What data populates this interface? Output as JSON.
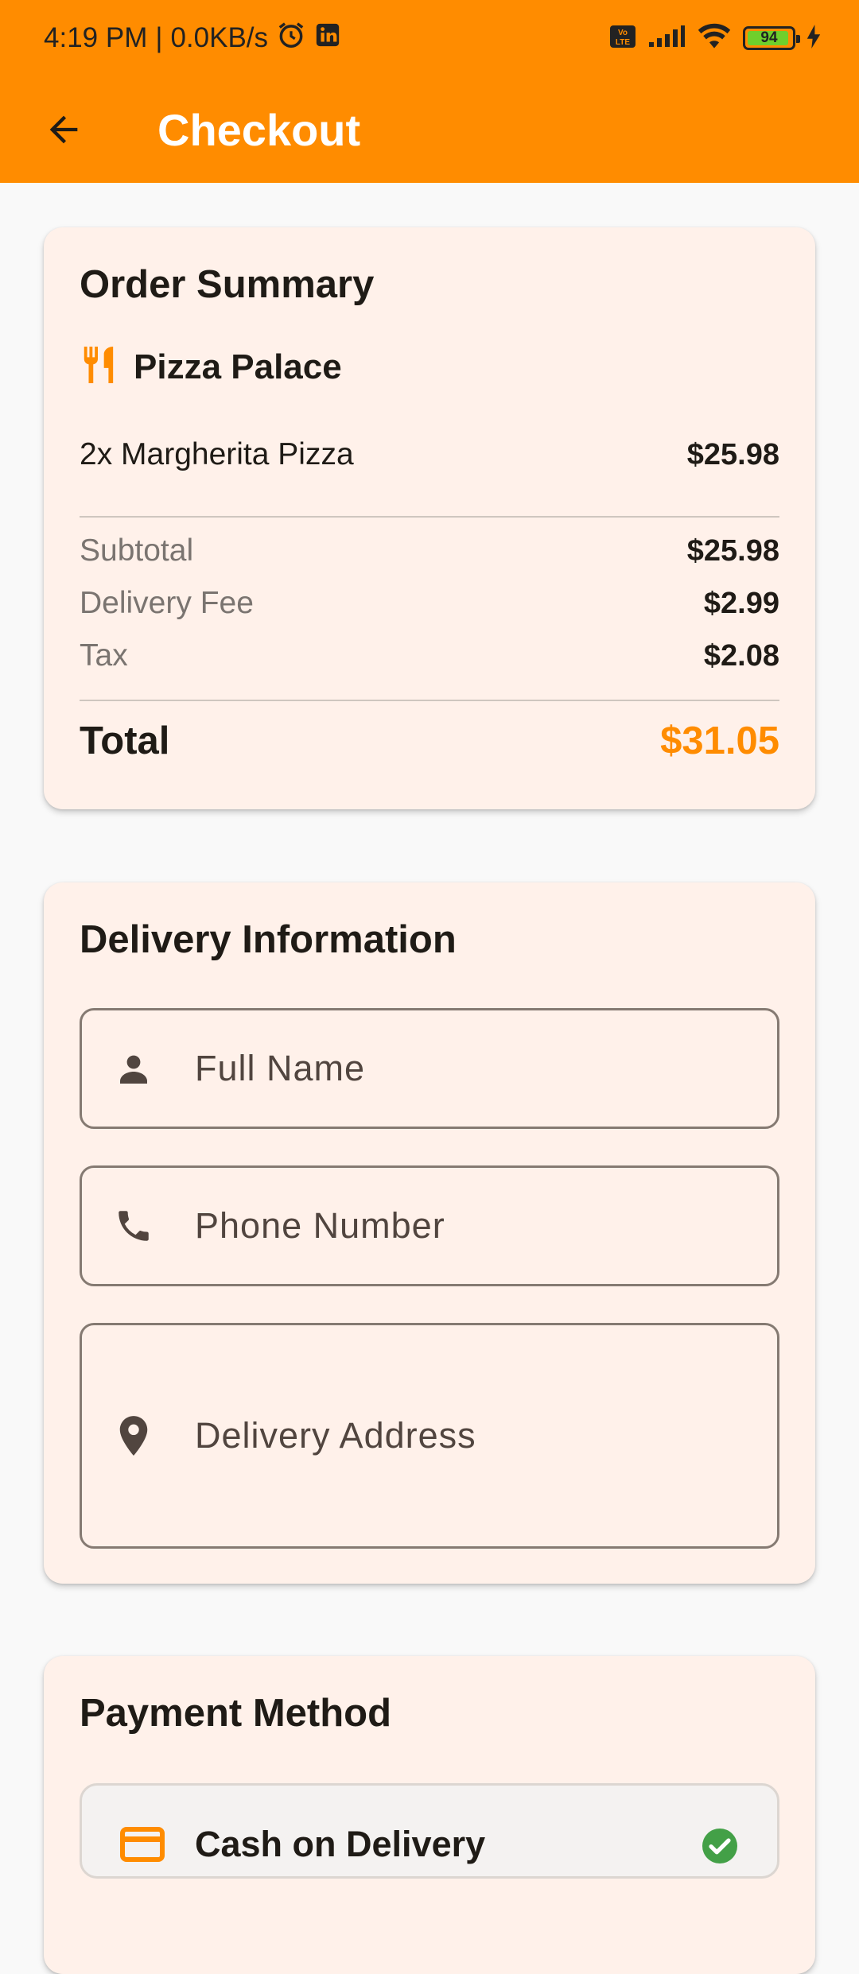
{
  "status_bar": {
    "time": "4:19 PM",
    "separator": "|",
    "net_speed": "0.0KB/s",
    "battery_level": 94,
    "icons": [
      "alarm-icon",
      "linkedin-icon",
      "volte-icon",
      "signal-icon",
      "wifi-icon",
      "battery-icon",
      "charging-icon"
    ]
  },
  "appbar": {
    "title": "Checkout",
    "background_color": "#ff8c00",
    "back_icon": "arrow-back-icon"
  },
  "order_summary": {
    "title": "Order Summary",
    "restaurant": {
      "icon": "restaurant-icon",
      "name": "Pizza Palace"
    },
    "items": [
      {
        "label": "2x Margherita Pizza",
        "price": "$25.98"
      }
    ],
    "subtotal": {
      "label": "Subtotal",
      "value": "$25.98"
    },
    "delivery_fee": {
      "label": "Delivery Fee",
      "value": "$2.99"
    },
    "tax": {
      "label": "Tax",
      "value": "$2.08"
    },
    "total": {
      "label": "Total",
      "value": "$31.05"
    }
  },
  "delivery_information": {
    "title": "Delivery Information",
    "fields": {
      "full_name": {
        "icon": "person-icon",
        "placeholder": "Full Name",
        "value": ""
      },
      "phone": {
        "icon": "phone-icon",
        "placeholder": "Phone Number",
        "value": ""
      },
      "address": {
        "icon": "location-icon",
        "placeholder": "Delivery Address",
        "value": ""
      }
    }
  },
  "payment_method": {
    "title": "Payment Method",
    "options": [
      {
        "label": "Cash on Delivery",
        "icon": "card-icon",
        "selected": true
      }
    ]
  },
  "colors": {
    "accent": "#ff8c00",
    "card_background": "#fff1ea",
    "selected_check": "#43a047"
  }
}
